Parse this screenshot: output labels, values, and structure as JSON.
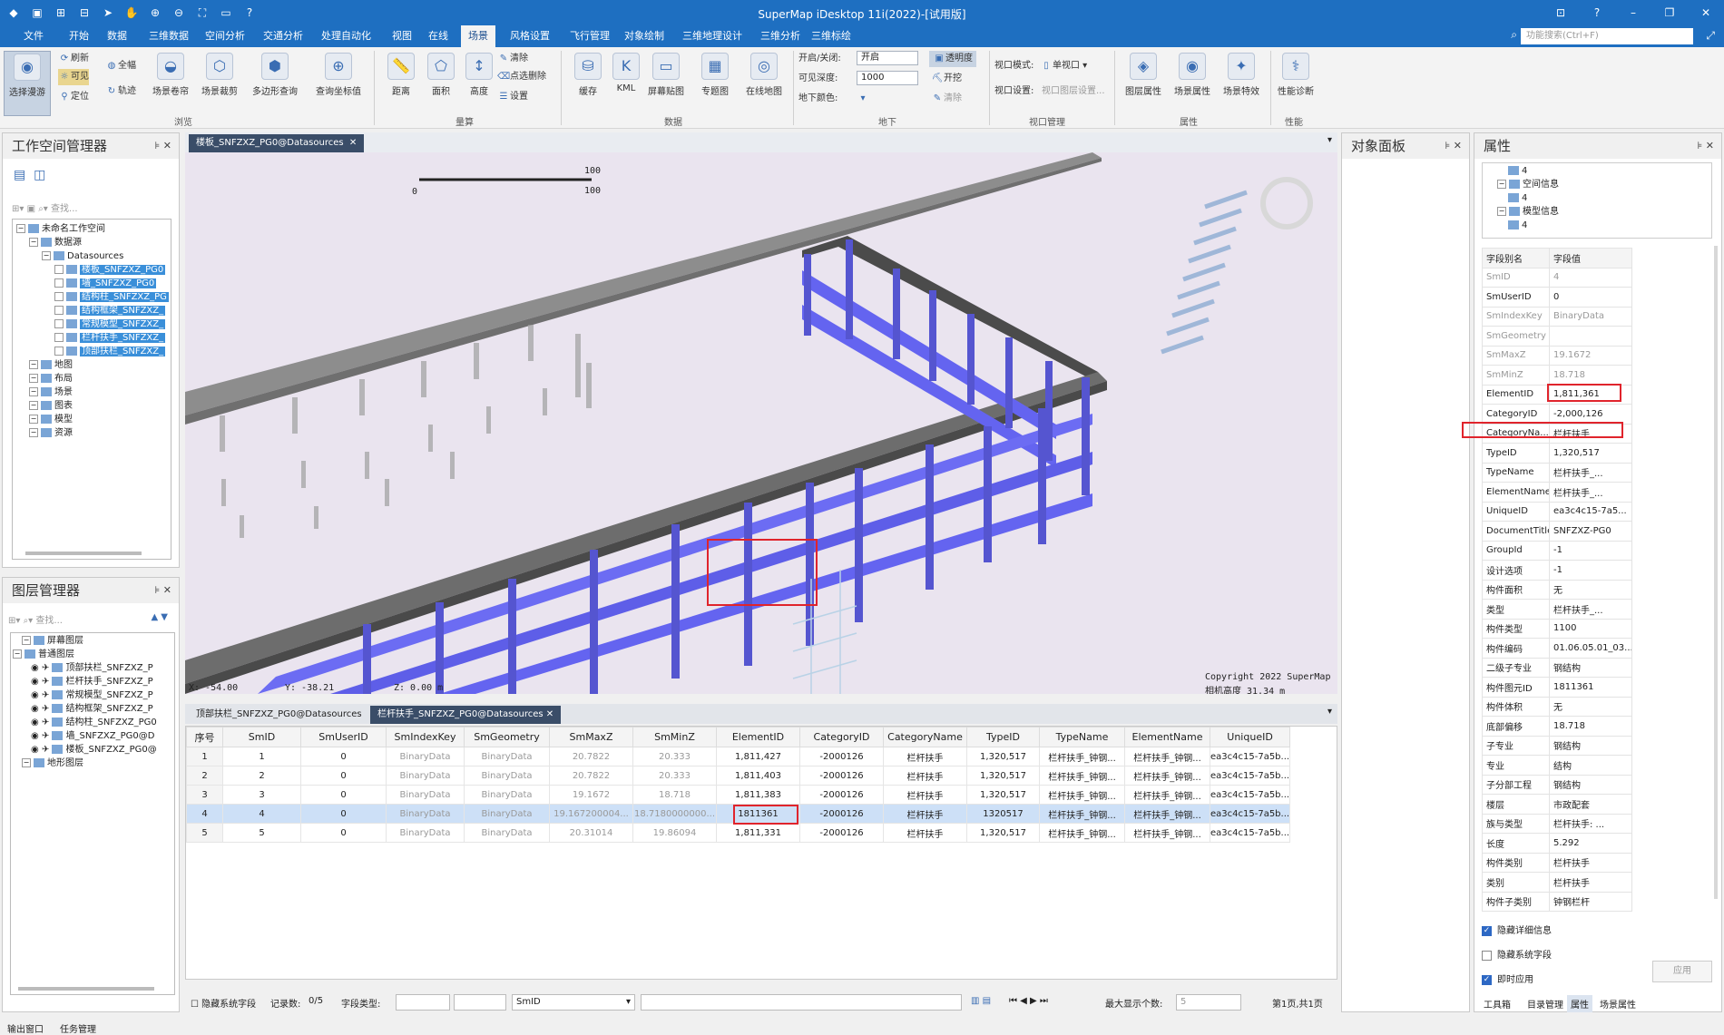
{
  "app": {
    "title": "SuperMap iDesktop 11i(2022)-[试用版]",
    "search_placeholder": "功能搜索(Ctrl+F)"
  },
  "menu": [
    "文件",
    "开始",
    "数据",
    "三维数据",
    "空间分析",
    "交通分析",
    "处理自动化",
    "视图",
    "在线",
    "场景",
    "风格设置",
    "飞行管理",
    "对象绘制",
    "三维地理设计",
    "三维分析",
    "三维标绘"
  ],
  "menu_active": 9,
  "ribbon": {
    "big": {
      "select_roam": "选择漫游",
      "scene_roll": "场景卷帘",
      "scene_clip": "场景裁剪",
      "polygon_query": "多边形查询",
      "query_coord": "查询坐标值",
      "distance": "距离",
      "area": "面积",
      "height": "高度",
      "cache": "缓存",
      "kml": "KML",
      "screen_paste": "屏幕贴图",
      "thematic": "专题图",
      "online_map": "在线地图",
      "layer_props": "图层属性",
      "scene_props": "场景属性",
      "scene_effects": "场景特效",
      "perf_diag": "性能诊断"
    },
    "small": {
      "refresh": "刷新",
      "full": "全幅",
      "visible": "可见",
      "track": "轨迹",
      "locate": "定位",
      "clear": "清除",
      "point_delete": "点选删除",
      "settings": "设置",
      "open_close": "开启/关闭:",
      "open_val": "开启",
      "visible_depth": "可见深度:",
      "depth_val": "1000",
      "underground_color": "地下颜色:",
      "transparency": "透明度",
      "excavate": "开挖",
      "clear2": "清除",
      "viewport_mode": "视口模式:",
      "single_view": "单视口",
      "viewport_settings": "视口设置:",
      "viewport_layer_settings": "视口图层设置..."
    },
    "groups": {
      "browse": "浏览",
      "measure": "量算",
      "data": "数据",
      "underground": "地下",
      "viewport_mgmt": "视口管理",
      "properties": "属性",
      "performance": "性能"
    }
  },
  "workspace": {
    "title": "工作空间管理器",
    "search": "查找...",
    "nodes": [
      {
        "label": "未命名工作空间",
        "level": 0,
        "hl": false
      },
      {
        "label": "数据源",
        "level": 1,
        "hl": false
      },
      {
        "label": "Datasources",
        "level": 2,
        "hl": false
      },
      {
        "label": "楼板_SNFZXZ_PG0",
        "level": 3,
        "hl": true
      },
      {
        "label": "墙_SNFZXZ_PG0",
        "level": 3,
        "hl": true
      },
      {
        "label": "结构柱_SNFZXZ_PG",
        "level": 3,
        "hl": true
      },
      {
        "label": "结构框架_SNFZXZ_",
        "level": 3,
        "hl": true
      },
      {
        "label": "常规模型_SNFZXZ_",
        "level": 3,
        "hl": true
      },
      {
        "label": "栏杆扶手_SNFZXZ_",
        "level": 3,
        "hl": true
      },
      {
        "label": "顶部扶栏_SNFZXZ_",
        "level": 3,
        "hl": true
      },
      {
        "label": "地图",
        "level": 1,
        "hl": false
      },
      {
        "label": "布局",
        "level": 1,
        "hl": false
      },
      {
        "label": "场景",
        "level": 1,
        "hl": false
      },
      {
        "label": "图表",
        "level": 1,
        "hl": false
      },
      {
        "label": "模型",
        "level": 1,
        "hl": false
      },
      {
        "label": "资源",
        "level": 1,
        "hl": false
      }
    ]
  },
  "layers": {
    "title": "图层管理器",
    "search": "查找...",
    "nodes": [
      {
        "label": "屏幕图层",
        "level": 1
      },
      {
        "label": "普通图层",
        "level": 0
      },
      {
        "label": "顶部扶栏_SNFZXZ_P",
        "level": 2
      },
      {
        "label": "栏杆扶手_SNFZXZ_P",
        "level": 2
      },
      {
        "label": "常规模型_SNFZXZ_P",
        "level": 2
      },
      {
        "label": "结构框架_SNFZXZ_P",
        "level": 2
      },
      {
        "label": "结构柱_SNFZXZ_PG0",
        "level": 2
      },
      {
        "label": "墙_SNFZXZ_PG0@D",
        "level": 2
      },
      {
        "label": "楼板_SNFZXZ_PG0@",
        "level": 2
      },
      {
        "label": "地形图层",
        "level": 1
      }
    ]
  },
  "doc_tab": "楼板_SNFZXZ_PG0@Datasources",
  "viewport": {
    "scale_top": "100",
    "scale_bottom": "100",
    "scale_zero": "0",
    "coord_x": "X: -54.00",
    "coord_y": "Y: -38.21",
    "coord_z": "Z: 0.00 m",
    "copyright": "Copyright 2022 SuperMap",
    "camera": "相机高度 31.34 m"
  },
  "attr_tabs": [
    "顶部扶栏_SNFZXZ_PG0@Datasources",
    "栏杆扶手_SNFZXZ_PG0@Datasources"
  ],
  "attr_active": 1,
  "table": {
    "headers": [
      "序号",
      "SmID",
      "SmUserID",
      "SmIndexKey",
      "SmGeometry",
      "SmMaxZ",
      "SmMinZ",
      "ElementID",
      "CategoryID",
      "CategoryName",
      "TypeID",
      "TypeName",
      "ElementName",
      "UniqueID"
    ],
    "rows": [
      [
        "1",
        "1",
        "0",
        "BinaryData",
        "BinaryData",
        "20.7822",
        "20.333",
        "1,811,427",
        "-2000126",
        "栏杆扶手",
        "1,320,517",
        "栏杆扶手_钟钢...",
        "栏杆扶手_钟钢...",
        "ea3c4c15-7a5b..."
      ],
      [
        "2",
        "2",
        "0",
        "BinaryData",
        "BinaryData",
        "20.7822",
        "20.333",
        "1,811,403",
        "-2000126",
        "栏杆扶手",
        "1,320,517",
        "栏杆扶手_钟钢...",
        "栏杆扶手_钟钢...",
        "ea3c4c15-7a5b..."
      ],
      [
        "3",
        "3",
        "0",
        "BinaryData",
        "BinaryData",
        "19.1672",
        "18.718",
        "1,811,383",
        "-2000126",
        "栏杆扶手",
        "1,320,517",
        "栏杆扶手_钟钢...",
        "栏杆扶手_钟钢...",
        "ea3c4c15-7a5b..."
      ],
      [
        "4",
        "4",
        "0",
        "BinaryData",
        "BinaryData",
        "19.167200004...",
        "18.7180000000...",
        "1811361",
        "-2000126",
        "栏杆扶手",
        "1320517",
        "栏杆扶手_钟钢...",
        "栏杆扶手_钟钢...",
        "ea3c4c15-7a5b..."
      ],
      [
        "5",
        "5",
        "0",
        "BinaryData",
        "BinaryData",
        "20.31014",
        "19.86094",
        "1,811,331",
        "-2000126",
        "栏杆扶手",
        "1,320,517",
        "栏杆扶手_钟钢...",
        "栏杆扶手_钟钢...",
        "ea3c4c15-7a5b..."
      ]
    ],
    "selected_row": 3
  },
  "status": {
    "hide_sys": "隐藏系统字段",
    "records": "记录数:",
    "records_val": "0/5",
    "field_type": "字段类型:",
    "field_val": "SmID",
    "max_show": "最大显示个数:",
    "max_val": "5",
    "page": "第1页,共1页"
  },
  "object_panel": {
    "title": "对象面板"
  },
  "properties": {
    "title": "属性",
    "tree": [
      {
        "label": "4",
        "level": 2
      },
      {
        "label": "空间信息",
        "level": 1
      },
      {
        "label": "4",
        "level": 2
      },
      {
        "label": "模型信息",
        "level": 1
      },
      {
        "label": "4",
        "level": 2
      }
    ],
    "head_k": "字段别名",
    "head_v": "字段值",
    "rows": [
      {
        "k": "SmID",
        "v": "4",
        "sys": true
      },
      {
        "k": "SmUserID",
        "v": "0",
        "sys": false
      },
      {
        "k": "SmIndexKey",
        "v": "BinaryData",
        "sys": true
      },
      {
        "k": "SmGeometry",
        "v": "",
        "sys": true
      },
      {
        "k": "SmMaxZ",
        "v": "19.1672",
        "sys": true
      },
      {
        "k": "SmMinZ",
        "v": "18.718",
        "sys": true
      },
      {
        "k": "ElementID",
        "v": "1,811,361",
        "sys": false
      },
      {
        "k": "CategoryID",
        "v": "-2,000,126",
        "sys": false
      },
      {
        "k": "CategoryNa...",
        "v": "栏杆扶手",
        "sys": false
      },
      {
        "k": "TypeID",
        "v": "1,320,517",
        "sys": false
      },
      {
        "k": "TypeName",
        "v": "栏杆扶手_...",
        "sys": false
      },
      {
        "k": "ElementName",
        "v": "栏杆扶手_...",
        "sys": false
      },
      {
        "k": "UniqueID",
        "v": "ea3c4c15-7a5...",
        "sys": false
      },
      {
        "k": "DocumentTitle",
        "v": "SNFZXZ-PG0",
        "sys": false
      },
      {
        "k": "GroupId",
        "v": "-1",
        "sys": false
      },
      {
        "k": "设计选项",
        "v": "-1",
        "sys": false
      },
      {
        "k": "构件面积",
        "v": "无",
        "sys": false
      },
      {
        "k": "类型",
        "v": "栏杆扶手_...",
        "sys": false
      },
      {
        "k": "构件类型",
        "v": "1100",
        "sys": false
      },
      {
        "k": "构件编码",
        "v": "01.06.05.01_03...",
        "sys": false
      },
      {
        "k": "二级子专业",
        "v": "钢结构",
        "sys": false
      },
      {
        "k": "构件图元ID",
        "v": "1811361",
        "sys": false
      },
      {
        "k": "构件体积",
        "v": "无",
        "sys": false
      },
      {
        "k": "底部偏移",
        "v": "18.718",
        "sys": false
      },
      {
        "k": "子专业",
        "v": "钢结构",
        "sys": false
      },
      {
        "k": "专业",
        "v": "结构",
        "sys": false
      },
      {
        "k": "子分部工程",
        "v": "钢结构",
        "sys": false
      },
      {
        "k": "楼层",
        "v": "市政配套",
        "sys": false
      },
      {
        "k": "族与类型",
        "v": "栏杆扶手: ...",
        "sys": false
      },
      {
        "k": "长度",
        "v": "5.292",
        "sys": false
      },
      {
        "k": "构件类别",
        "v": "栏杆扶手",
        "sys": false
      },
      {
        "k": "类别",
        "v": "栏杆扶手",
        "sys": false
      },
      {
        "k": "构件子类别",
        "v": "钟钢栏杆",
        "sys": false
      }
    ],
    "checks": [
      {
        "label": "隐藏详细信息",
        "on": true
      },
      {
        "label": "隐藏系统字段",
        "on": false
      },
      {
        "label": "即时应用",
        "on": true
      }
    ],
    "apply": "应用",
    "bottom_tabs": [
      "工具箱",
      "目录管理",
      "属性",
      "场景属性"
    ],
    "bottom_active": 2
  },
  "bottom": {
    "output": "输出窗口",
    "tasks": "任务管理"
  },
  "colors": {
    "accent": "#1e6fc1",
    "railing": "#6464f0",
    "highlight": "#e0242c"
  }
}
